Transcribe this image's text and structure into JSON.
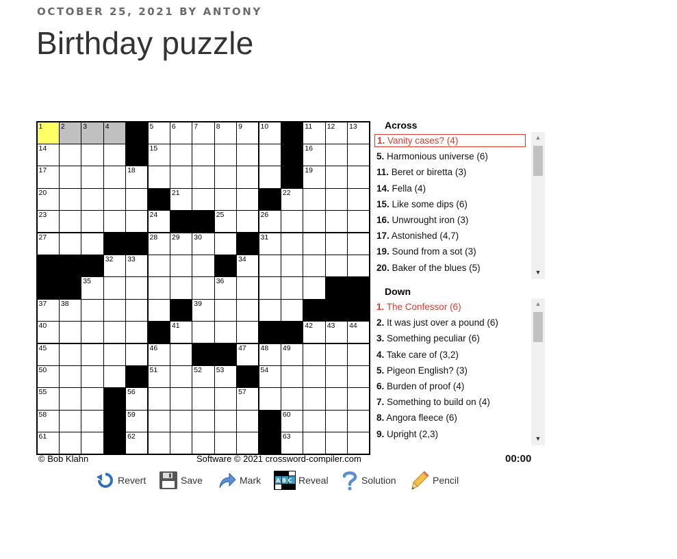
{
  "post": {
    "meta": "OCTOBER 25, 2021 BY ANTONY",
    "title": "Birthday puzzle"
  },
  "puzzle": {
    "size": 15,
    "rows": [
      "...._......_...",
      "...._......_...",
      "..........._...",
      "....._....._...",
      "....._.._......",
      "...._.....#....",
      "___..........._",
      "__............_",
      "......#......__",
      "......_...__...",
      ".......__.......",
      "......_....._...",
      "....._..........",
      "....._.....#....",
      "....._.....#...."
    ],
    "blocks": [
      [
        0,
        4
      ],
      [
        0,
        11
      ],
      [
        1,
        4
      ],
      [
        1,
        11
      ],
      [
        2,
        11
      ],
      [
        3,
        5
      ],
      [
        3,
        10
      ],
      [
        4,
        6
      ],
      [
        4,
        7
      ],
      [
        5,
        3
      ],
      [
        5,
        4
      ],
      [
        5,
        9
      ],
      [
        6,
        0
      ],
      [
        6,
        1
      ],
      [
        6,
        2
      ],
      [
        6,
        8
      ],
      [
        7,
        0
      ],
      [
        7,
        1
      ],
      [
        7,
        13
      ],
      [
        7,
        14
      ],
      [
        8,
        6
      ],
      [
        8,
        12
      ],
      [
        8,
        13
      ],
      [
        8,
        14
      ],
      [
        9,
        5
      ],
      [
        9,
        10
      ],
      [
        9,
        11
      ],
      [
        10,
        7
      ],
      [
        10,
        8
      ],
      [
        11,
        4
      ],
      [
        11,
        9
      ],
      [
        12,
        3
      ],
      [
        13,
        3
      ],
      [
        13,
        10
      ],
      [
        14,
        3
      ],
      [
        14,
        10
      ]
    ],
    "numbers": [
      [
        0,
        0,
        "1"
      ],
      [
        0,
        1,
        "2"
      ],
      [
        0,
        2,
        "3"
      ],
      [
        0,
        3,
        "4"
      ],
      [
        0,
        5,
        "5"
      ],
      [
        0,
        6,
        "6"
      ],
      [
        0,
        7,
        "7"
      ],
      [
        0,
        8,
        "8"
      ],
      [
        0,
        9,
        "9"
      ],
      [
        0,
        10,
        "10"
      ],
      [
        0,
        12,
        "11"
      ],
      [
        0,
        13,
        "12"
      ],
      [
        0,
        14,
        "13"
      ],
      [
        1,
        0,
        "14"
      ],
      [
        1,
        5,
        "15"
      ],
      [
        1,
        12,
        "16"
      ],
      [
        2,
        0,
        "17"
      ],
      [
        2,
        4,
        "18"
      ],
      [
        2,
        12,
        "19"
      ],
      [
        3,
        0,
        "20"
      ],
      [
        3,
        6,
        "21"
      ],
      [
        3,
        11,
        "22"
      ],
      [
        4,
        0,
        "23"
      ],
      [
        4,
        5,
        "24"
      ],
      [
        4,
        8,
        "25"
      ],
      [
        4,
        10,
        "26"
      ],
      [
        5,
        0,
        "27"
      ],
      [
        5,
        5,
        "28"
      ],
      [
        5,
        6,
        "29"
      ],
      [
        5,
        7,
        "30"
      ],
      [
        5,
        10,
        "31"
      ],
      [
        6,
        3,
        "32"
      ],
      [
        6,
        4,
        "33"
      ],
      [
        6,
        9,
        "34"
      ],
      [
        7,
        2,
        "35"
      ],
      [
        7,
        8,
        "36"
      ],
      [
        8,
        0,
        "37"
      ],
      [
        8,
        1,
        "38"
      ],
      [
        8,
        7,
        "39"
      ],
      [
        9,
        0,
        "40"
      ],
      [
        9,
        6,
        "41"
      ],
      [
        9,
        12,
        "42"
      ],
      [
        9,
        13,
        "43"
      ],
      [
        9,
        14,
        "44"
      ],
      [
        10,
        0,
        "45"
      ],
      [
        10,
        5,
        "46"
      ],
      [
        10,
        9,
        "47"
      ],
      [
        10,
        10,
        "48"
      ],
      [
        10,
        11,
        "49"
      ],
      [
        11,
        0,
        "50"
      ],
      [
        11,
        5,
        "51"
      ],
      [
        11,
        7,
        "52"
      ],
      [
        11,
        8,
        "53"
      ],
      [
        11,
        10,
        "54"
      ],
      [
        12,
        0,
        "55"
      ],
      [
        12,
        4,
        "56"
      ],
      [
        12,
        9,
        "57"
      ],
      [
        13,
        0,
        "58"
      ],
      [
        13,
        4,
        "59"
      ],
      [
        13,
        11,
        "60"
      ],
      [
        14,
        0,
        "61"
      ],
      [
        14,
        4,
        "62"
      ],
      [
        14,
        11,
        "63"
      ]
    ],
    "active_cell": [
      0,
      0
    ],
    "highlighted_cells": [
      [
        0,
        1
      ],
      [
        0,
        2
      ],
      [
        0,
        3
      ]
    ]
  },
  "credits": {
    "author": "© Bob Klahn",
    "software": "Software © 2021 crossword-compiler.com",
    "timer": "00:00"
  },
  "across": {
    "heading": "Across",
    "clues": [
      {
        "num": "1.",
        "text": " Vanity cases? (4)",
        "selected": true
      },
      {
        "num": "5.",
        "text": " Harmonious universe (6)"
      },
      {
        "num": "11.",
        "text": " Beret or biretta (3)"
      },
      {
        "num": "14.",
        "text": " Fella (4)"
      },
      {
        "num": "15.",
        "text": " Like some dips (6)"
      },
      {
        "num": "16.",
        "text": " Unwrought iron (3)"
      },
      {
        "num": "17.",
        "text": " Astonished (4,7)"
      },
      {
        "num": "19.",
        "text": " Sound from a sot (3)"
      },
      {
        "num": "20.",
        "text": " Baker of the blues (5)"
      }
    ]
  },
  "down": {
    "heading": "Down",
    "clues": [
      {
        "num": "1.",
        "text": " The Confessor (6)",
        "selected": true
      },
      {
        "num": "2.",
        "text": " It was just over a pound (6)"
      },
      {
        "num": "3.",
        "text": " Something peculiar (6)"
      },
      {
        "num": "4.",
        "text": " Take care of (3,2)"
      },
      {
        "num": "5.",
        "text": " Pigeon English? (3)"
      },
      {
        "num": "6.",
        "text": " Burden of proof (4)"
      },
      {
        "num": "7.",
        "text": " Something to build on (4)"
      },
      {
        "num": "8.",
        "text": " Angora fleece (6)"
      },
      {
        "num": "9.",
        "text": " Upright (2,3)"
      }
    ]
  },
  "toolbar": {
    "revert": "Revert",
    "save": "Save",
    "mark": "Mark",
    "reveal": "Reveal",
    "reveal_icon_text": "ABC",
    "solution": "Solution",
    "pencil": "Pencil"
  },
  "colors": {
    "active": "#ffff66",
    "highlight": "#c0c0c0",
    "selected_clue": "#e0392b"
  }
}
